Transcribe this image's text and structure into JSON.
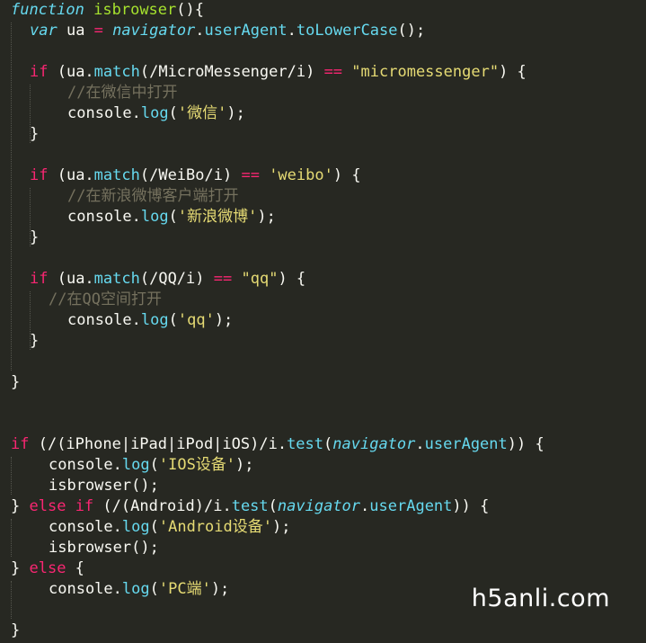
{
  "lines": [
    {
      "indent": 0,
      "tokens": [
        {
          "t": "function",
          "c": "ty"
        },
        {
          "t": " ",
          "c": "ob"
        },
        {
          "t": "isbrowser",
          "c": "fn"
        },
        {
          "t": "(){",
          "c": "ob"
        }
      ]
    },
    {
      "indent": 1,
      "tokens": [
        {
          "t": "var",
          "c": "ty"
        },
        {
          "t": " ua ",
          "c": "ob"
        },
        {
          "t": "=",
          "c": "kw"
        },
        {
          "t": " ",
          "c": "ob"
        },
        {
          "t": "navigator",
          "c": "sv"
        },
        {
          "t": ".",
          "c": "ob"
        },
        {
          "t": "userAgent",
          "c": "ty2"
        },
        {
          "t": ".",
          "c": "ob"
        },
        {
          "t": "toLowerCase",
          "c": "ty2"
        },
        {
          "t": "();",
          "c": "ob"
        }
      ]
    },
    {
      "indent": 0,
      "tokens": []
    },
    {
      "indent": 1,
      "tokens": [
        {
          "t": "if",
          "c": "kw"
        },
        {
          "t": " (ua.",
          "c": "ob"
        },
        {
          "t": "match",
          "c": "ty2"
        },
        {
          "t": "(/MicroMessenger/i) ",
          "c": "ob"
        },
        {
          "t": "==",
          "c": "kw"
        },
        {
          "t": " ",
          "c": "ob"
        },
        {
          "t": "\"micromessenger\"",
          "c": "st"
        },
        {
          "t": ") {",
          "c": "ob"
        }
      ]
    },
    {
      "indent": 3,
      "tokens": [
        {
          "t": "//在微信中打开",
          "c": "cm"
        }
      ]
    },
    {
      "indent": 3,
      "tokens": [
        {
          "t": "console.",
          "c": "ob"
        },
        {
          "t": "log",
          "c": "ty2"
        },
        {
          "t": "(",
          "c": "ob"
        },
        {
          "t": "'微信'",
          "c": "st"
        },
        {
          "t": ");",
          "c": "ob"
        }
      ]
    },
    {
      "indent": 1,
      "tokens": [
        {
          "t": "}",
          "c": "ob"
        }
      ]
    },
    {
      "indent": 0,
      "tokens": []
    },
    {
      "indent": 1,
      "tokens": [
        {
          "t": "if",
          "c": "kw"
        },
        {
          "t": " (ua.",
          "c": "ob"
        },
        {
          "t": "match",
          "c": "ty2"
        },
        {
          "t": "(/WeiBo/i) ",
          "c": "ob"
        },
        {
          "t": "==",
          "c": "kw"
        },
        {
          "t": " ",
          "c": "ob"
        },
        {
          "t": "'weibo'",
          "c": "st"
        },
        {
          "t": ") {",
          "c": "ob"
        }
      ]
    },
    {
      "indent": 3,
      "tokens": [
        {
          "t": "//在新浪微博客户端打开",
          "c": "cm"
        }
      ]
    },
    {
      "indent": 3,
      "tokens": [
        {
          "t": "console.",
          "c": "ob"
        },
        {
          "t": "log",
          "c": "ty2"
        },
        {
          "t": "(",
          "c": "ob"
        },
        {
          "t": "'新浪微博'",
          "c": "st"
        },
        {
          "t": ");",
          "c": "ob"
        }
      ]
    },
    {
      "indent": 1,
      "tokens": [
        {
          "t": "}",
          "c": "ob"
        }
      ]
    },
    {
      "indent": 0,
      "tokens": []
    },
    {
      "indent": 1,
      "tokens": [
        {
          "t": "if",
          "c": "kw"
        },
        {
          "t": " (ua.",
          "c": "ob"
        },
        {
          "t": "match",
          "c": "ty2"
        },
        {
          "t": "(/QQ/i) ",
          "c": "ob"
        },
        {
          "t": "==",
          "c": "kw"
        },
        {
          "t": " ",
          "c": "ob"
        },
        {
          "t": "\"qq\"",
          "c": "st"
        },
        {
          "t": ") {",
          "c": "ob"
        }
      ]
    },
    {
      "indent": 2,
      "tokens": [
        {
          "t": "//在QQ空间打开",
          "c": "cm"
        }
      ]
    },
    {
      "indent": 3,
      "tokens": [
        {
          "t": "console.",
          "c": "ob"
        },
        {
          "t": "log",
          "c": "ty2"
        },
        {
          "t": "(",
          "c": "ob"
        },
        {
          "t": "'qq'",
          "c": "st"
        },
        {
          "t": ");",
          "c": "ob"
        }
      ]
    },
    {
      "indent": 1,
      "tokens": [
        {
          "t": "}",
          "c": "ob"
        }
      ]
    },
    {
      "indent": 0,
      "tokens": []
    },
    {
      "indent": 0,
      "tokens": [
        {
          "t": "}",
          "c": "ob"
        }
      ]
    },
    {
      "indent": 0,
      "tokens": []
    },
    {
      "indent": 0,
      "tokens": []
    },
    {
      "indent": 0,
      "tokens": [
        {
          "t": "if",
          "c": "kw"
        },
        {
          "t": " (/(iPhone|iPad|iPod|iOS)/i.",
          "c": "ob"
        },
        {
          "t": "test",
          "c": "ty2"
        },
        {
          "t": "(",
          "c": "ob"
        },
        {
          "t": "navigator",
          "c": "sv"
        },
        {
          "t": ".",
          "c": "ob"
        },
        {
          "t": "userAgent",
          "c": "ty2"
        },
        {
          "t": ")) {",
          "c": "ob"
        }
      ]
    },
    {
      "indent": 2,
      "tokens": [
        {
          "t": "console.",
          "c": "ob"
        },
        {
          "t": "log",
          "c": "ty2"
        },
        {
          "t": "(",
          "c": "ob"
        },
        {
          "t": "'IOS设备'",
          "c": "st"
        },
        {
          "t": ");",
          "c": "ob"
        }
      ]
    },
    {
      "indent": 2,
      "tokens": [
        {
          "t": "isbrowser();",
          "c": "ob"
        }
      ]
    },
    {
      "indent": 0,
      "tokens": [
        {
          "t": "} ",
          "c": "ob"
        },
        {
          "t": "else",
          "c": "kw"
        },
        {
          "t": " ",
          "c": "ob"
        },
        {
          "t": "if",
          "c": "kw"
        },
        {
          "t": " (/(Android)/i.",
          "c": "ob"
        },
        {
          "t": "test",
          "c": "ty2"
        },
        {
          "t": "(",
          "c": "ob"
        },
        {
          "t": "navigator",
          "c": "sv"
        },
        {
          "t": ".",
          "c": "ob"
        },
        {
          "t": "userAgent",
          "c": "ty2"
        },
        {
          "t": ")) {",
          "c": "ob"
        }
      ]
    },
    {
      "indent": 2,
      "tokens": [
        {
          "t": "console.",
          "c": "ob"
        },
        {
          "t": "log",
          "c": "ty2"
        },
        {
          "t": "(",
          "c": "ob"
        },
        {
          "t": "'Android设备'",
          "c": "st"
        },
        {
          "t": ");",
          "c": "ob"
        }
      ]
    },
    {
      "indent": 2,
      "tokens": [
        {
          "t": "isbrowser();",
          "c": "ob"
        }
      ]
    },
    {
      "indent": 0,
      "tokens": [
        {
          "t": "} ",
          "c": "ob"
        },
        {
          "t": "else",
          "c": "kw"
        },
        {
          "t": " {",
          "c": "ob"
        }
      ]
    },
    {
      "indent": 2,
      "tokens": [
        {
          "t": "console.",
          "c": "ob"
        },
        {
          "t": "log",
          "c": "ty2"
        },
        {
          "t": "(",
          "c": "ob"
        },
        {
          "t": "'PC端'",
          "c": "st"
        },
        {
          "t": ");",
          "c": "ob"
        }
      ]
    },
    {
      "indent": 0,
      "tokens": []
    },
    {
      "indent": 0,
      "tokens": [
        {
          "t": "}",
          "c": "ob"
        }
      ]
    }
  ],
  "watermark": "h5anli.com",
  "colors": {
    "background": "#272822",
    "keyword": "#f92672",
    "function_name": "#a6e22e",
    "string": "#e6db74",
    "comment": "#75715e",
    "storage": "#66d9ef",
    "plain": "#f8f8f2"
  }
}
